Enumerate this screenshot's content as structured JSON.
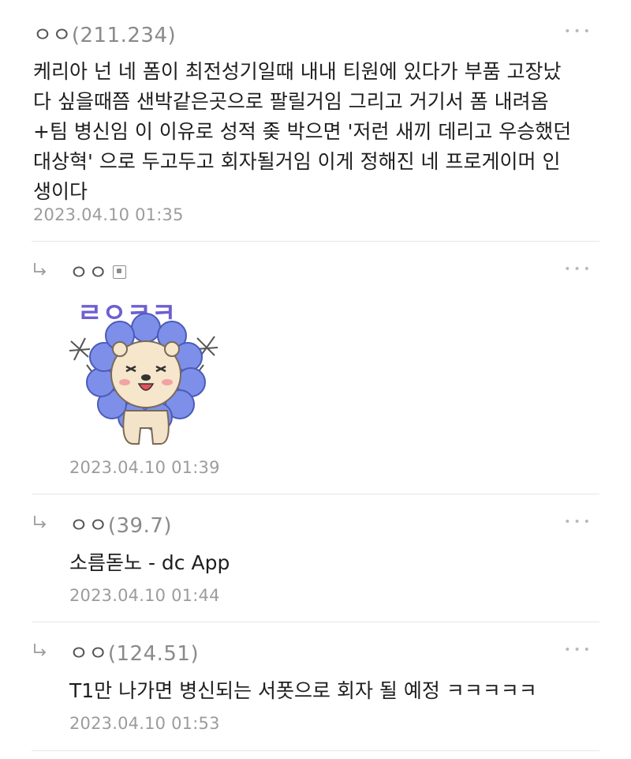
{
  "comments": [
    {
      "author": "ㅇㅇ",
      "ip": "(211.234)",
      "text_lines": [
        "케리아 넌 네 폼이 최전성기일때 내내 티원에 있다가 부품 고장났",
        "다 싶을때쯤 샌박같은곳으로 팔릴거임 그리고 거기서 폼 내려옴",
        "+팀 병신임 이 이유로 성적 좆 박으면 '저런 새끼 데리고 우승했던",
        "대상혁' 으로 두고두고 회자될거임 이게 정해진 네 프로게이머 인",
        "생이다"
      ],
      "time": "2023.04.10 01:35"
    },
    {
      "author": "ㅇㅇ",
      "sticker_text": "ㄹㅇㅋㅋ",
      "time": "2023.04.10 01:39"
    },
    {
      "author": "ㅇㅇ",
      "ip": "(39.7)",
      "text": "소름돋노 - dc App",
      "time": "2023.04.10 01:44"
    },
    {
      "author": "ㅇㅇ",
      "ip": "(124.51)",
      "text": "T1만 나가면 병신되는 서폿으로 회자 될 예정 ㅋㅋㅋㅋㅋ",
      "time": "2023.04.10 01:53"
    }
  ],
  "more_label": "•••",
  "icons": {
    "reply": "reply-arrow-icon",
    "more": "more-dots-icon",
    "badge": "fixed-nick-badge-icon"
  }
}
